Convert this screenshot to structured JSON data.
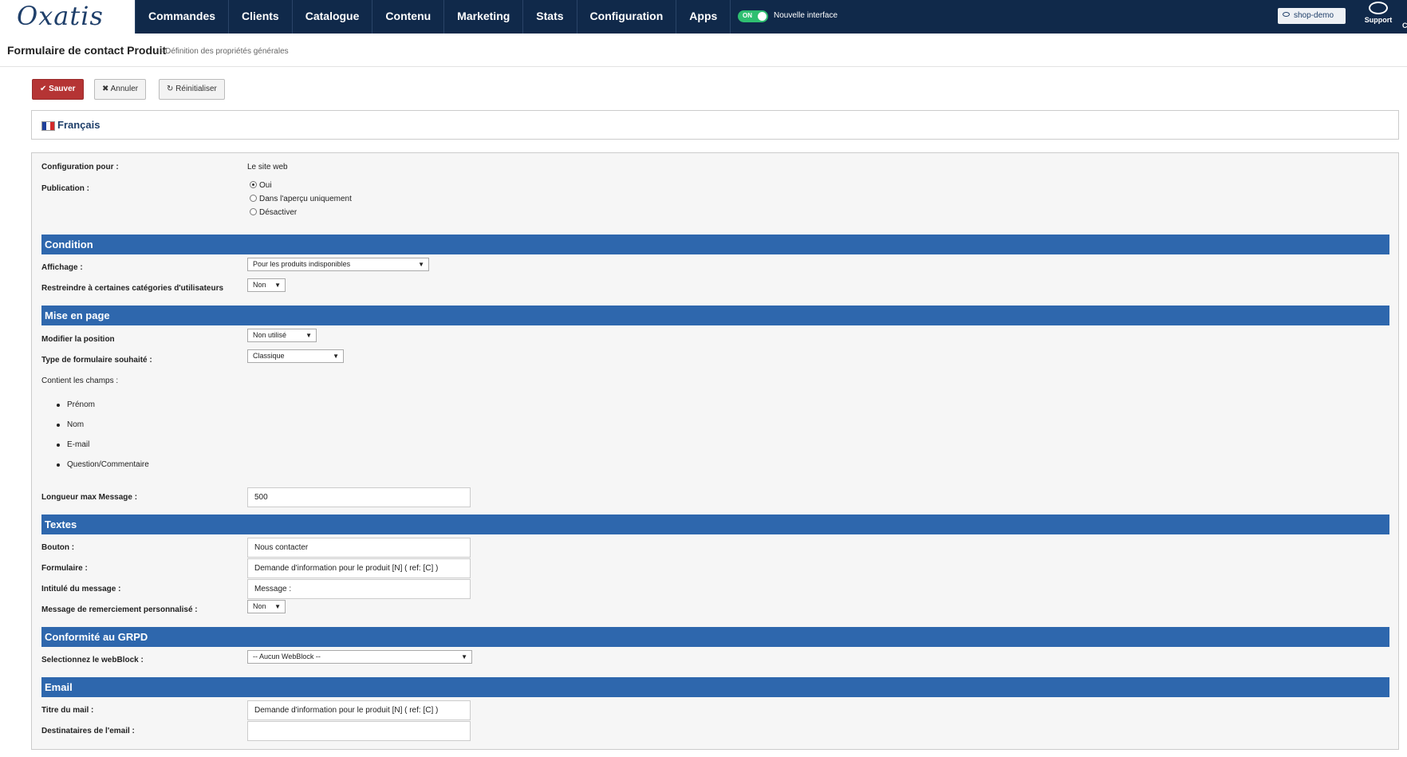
{
  "app": {
    "logo": "Oxatis",
    "nav": [
      "Commandes",
      "Clients",
      "Catalogue",
      "Contenu",
      "Marketing",
      "Stats",
      "Configuration",
      "Apps"
    ],
    "toggle": {
      "state": "ON",
      "label": "Nouvelle interface"
    },
    "shop_button": "shop-demo",
    "support_label": "Support",
    "extra_label": "C"
  },
  "page": {
    "title": "Formulaire de contact Produit",
    "subtitle": "- Définition des propriétés générales"
  },
  "actions": {
    "save": "Sauver",
    "cancel": "Annuler",
    "reset": "Réinitialiser"
  },
  "language": "Français",
  "form": {
    "config": {
      "label": "Configuration pour :",
      "value": "Le site web"
    },
    "publication": {
      "label": "Publication :",
      "options": [
        "Oui",
        "Dans l'aperçu uniquement",
        "Désactiver"
      ],
      "selected": "Oui"
    },
    "condition": {
      "title": "Condition",
      "affichage": {
        "label": "Affichage :",
        "value": "Pour les produits indisponibles"
      },
      "restreindre": {
        "label": "Restreindre à certaines catégories d'utilisateurs",
        "value": "Non"
      }
    },
    "mise_en_page": {
      "title": "Mise en page",
      "position": {
        "label": "Modifier la position",
        "value": "Non utilisé"
      },
      "type": {
        "label": "Type de formulaire souhaité :",
        "value": "Classique"
      },
      "contains_label": "Contient les champs :",
      "fields": [
        "Prénom",
        "Nom",
        "E-mail",
        "Question/Commentaire"
      ],
      "max_length": {
        "label": "Longueur max Message :",
        "value": "500"
      }
    },
    "textes": {
      "title": "Textes",
      "bouton": {
        "label": "Bouton :",
        "value": "Nous contacter"
      },
      "formulaire": {
        "label": "Formulaire :",
        "value": "Demande d'information pour le produit [N] ( ref: [C] )"
      },
      "intitule": {
        "label": "Intitulé du message :",
        "value": "Message :"
      },
      "remerciement": {
        "label": "Message de remerciement personnalisé :",
        "value": "Non"
      }
    },
    "grpd": {
      "title": "Conformité au GRPD",
      "webblock": {
        "label": "Selectionnez le webBlock :",
        "value": "-- Aucun WebBlock --"
      }
    },
    "email": {
      "title": "Email",
      "titre": {
        "label": "Titre du mail :",
        "value": "Demande d'information pour le produit [N] ( ref: [C] )"
      },
      "destinataires": {
        "label": "Destinataires de l'email :",
        "value": ""
      }
    }
  },
  "colors": {
    "nav_bg": "#10294a",
    "section_bg": "#2e67ad",
    "save_btn": "#b53434",
    "toggle_on": "#2fbf71"
  }
}
